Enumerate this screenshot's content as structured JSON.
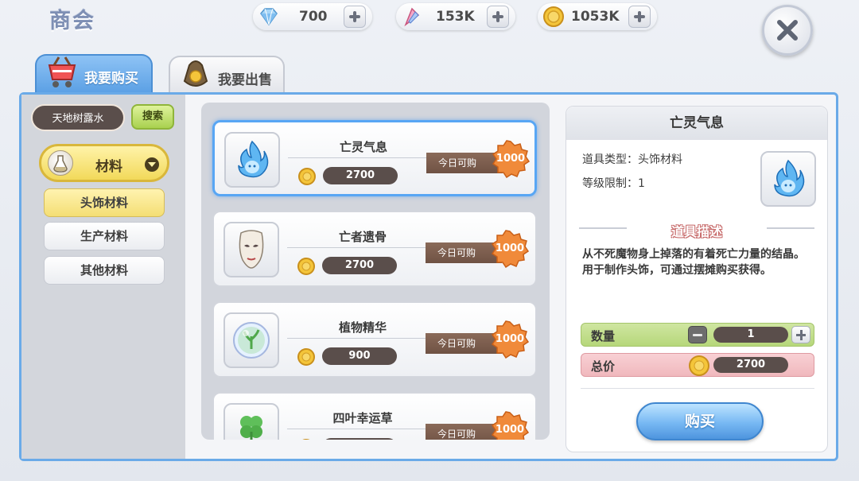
{
  "header": {
    "title": "商会"
  },
  "currencies": [
    {
      "icon": "diamond-icon",
      "value": "700"
    },
    {
      "icon": "crystal-feather-icon",
      "value": "153K"
    },
    {
      "icon": "gold-coin-icon",
      "value": "1053K"
    }
  ],
  "tabs": [
    {
      "label": "我要购买",
      "icon": "shop-cart-icon",
      "active": true
    },
    {
      "label": "我要出售",
      "icon": "money-bag-icon",
      "active": false
    }
  ],
  "search": {
    "value": "天地树露水",
    "button_label": "搜索"
  },
  "categories": {
    "main_label": "材料",
    "main_icon": "potion-flask-icon",
    "subcategories": [
      {
        "label": "头饰材料",
        "active": true
      },
      {
        "label": "生产材料",
        "active": false
      },
      {
        "label": "其他材料",
        "active": false
      }
    ]
  },
  "items": [
    {
      "name": "亡灵气息",
      "icon": "blue-soul-flame-icon",
      "price": "2700",
      "ribbon": "今日可购",
      "limit": "1000",
      "selected": true
    },
    {
      "name": "亡者遗骨",
      "icon": "white-mask-icon",
      "price": "2700",
      "ribbon": "今日可购",
      "limit": "1000",
      "selected": false
    },
    {
      "name": "植物精华",
      "icon": "green-orb-icon",
      "price": "900",
      "ribbon": "今日可购",
      "limit": "1000",
      "selected": false
    },
    {
      "name": "四叶幸运草",
      "icon": "four-leaf-clover-icon",
      "price": "",
      "ribbon": "今日可购",
      "limit": "1000",
      "selected": false
    }
  ],
  "detail": {
    "title": "亡灵气息",
    "type_line": "道具类型：头饰材料",
    "level_line": "等级限制：1",
    "section_title": "道具描述",
    "description": "从不死魔物身上掉落的有着死亡力量的结晶。用于制作头饰，可通过摆摊购买获得。",
    "quantity_label": "数量",
    "quantity_value": "1",
    "total_label": "总价",
    "total_value": "2700",
    "buy_label": "购买"
  },
  "colors": {
    "accent_blue": "#58a6f4",
    "price_pill": "#5a4e4b",
    "badge_orange": "#f08a3a",
    "tab_active": "#5a9fe4",
    "category_yellow": "#f4de74"
  }
}
